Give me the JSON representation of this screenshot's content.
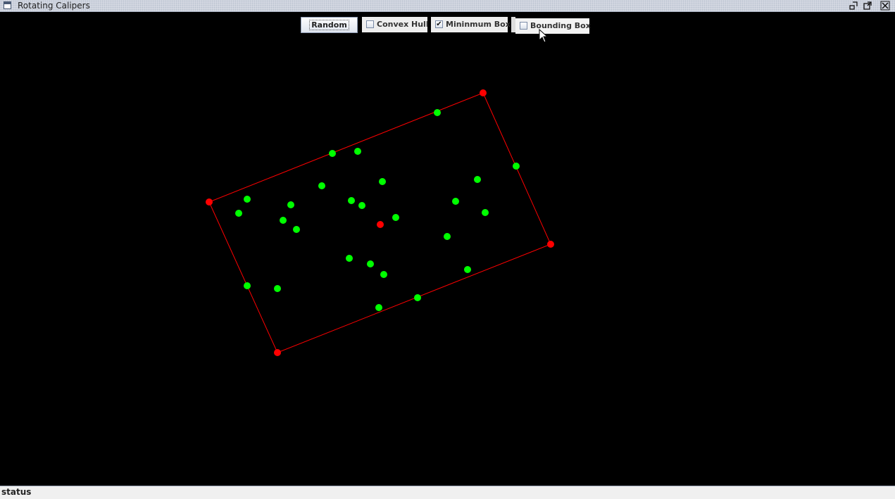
{
  "window": {
    "title": "Rotating Calipers",
    "controls": [
      "minimize-icon",
      "maximize-icon",
      "close-icon"
    ]
  },
  "toolbar": {
    "random_label": "Random",
    "checkboxes": [
      {
        "label": "Convex Hull",
        "checked": false
      },
      {
        "label": "Mininmum Box",
        "checked": true
      },
      {
        "label": "Bounding Box",
        "checked": false
      }
    ]
  },
  "status": {
    "text": "status"
  },
  "colors": {
    "background": "#000000",
    "point": "#00ff00",
    "box_corner": "#ff0000",
    "box_line": "#ff0000"
  }
}
